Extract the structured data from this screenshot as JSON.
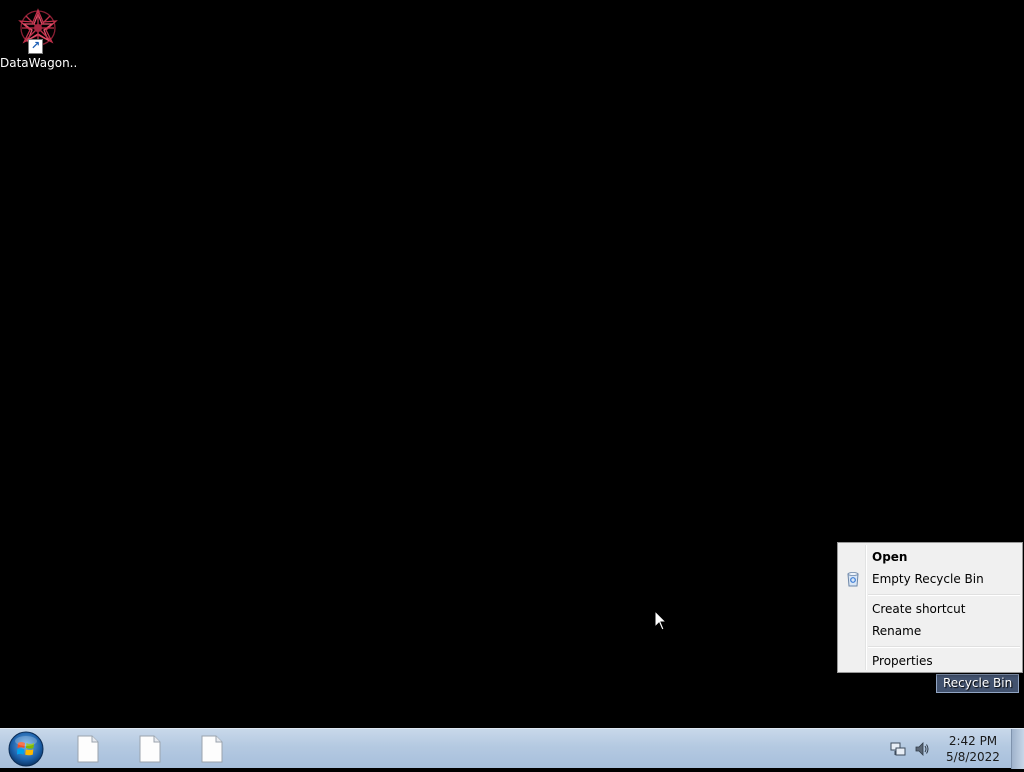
{
  "desktop": {
    "icons": [
      {
        "label": "DataWagon..."
      },
      {
        "label": "Recycle Bin"
      }
    ]
  },
  "context_menu": {
    "items": [
      {
        "label": "Open",
        "bold": true
      },
      {
        "label": "Empty Recycle Bin",
        "icon": "recycle-bin-icon"
      },
      {
        "label": "Create shortcut"
      },
      {
        "label": "Rename"
      },
      {
        "label": "Properties"
      }
    ]
  },
  "taskbar": {
    "start_icon": "windows-start-orb-icon",
    "pinned": [
      {
        "icon": "blank-document-icon"
      },
      {
        "icon": "blank-document-icon"
      },
      {
        "icon": "blank-document-icon"
      }
    ],
    "tray": {
      "icons": [
        "network-icon",
        "volume-icon"
      ],
      "time": "2:42 PM",
      "date": "5/8/2022"
    }
  },
  "colors": {
    "desktop_bg": "#000000",
    "taskbar_top": "#c8d8ea",
    "taskbar_bottom": "#a7bfdc",
    "menu_bg": "#f0f0f0",
    "selection_bg": "#7896c8"
  }
}
